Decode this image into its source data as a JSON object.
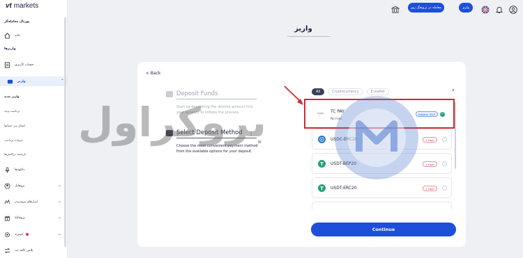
{
  "brand": {
    "logo_mark": "vt",
    "logo_text": "markets"
  },
  "sidebar": {
    "section_portal": "پورتال معامله‌گر",
    "home": "خانه",
    "section_transfers": "واریزها",
    "my_accounts": "حساب کاربری",
    "deposit": "واریز",
    "sub_new_deposit": "واریز جدید",
    "sub_withdraw": "برداشت وجه",
    "sub_internal_transfer": "انتقال بین حسابها",
    "sub_payment_history": "جزئیات پرداخت",
    "sub_transaction_history": "تاریخچه تراکنش‌ها",
    "downloads": "دانلودها",
    "profile": "پروفایل",
    "trading_tools": "ابزارهای پروتریدر",
    "promotions": "پروفایلهٔ",
    "settings": "کپیترید",
    "copy_trading": "پلاس کافه نت"
  },
  "topbar": {
    "demo_button": "معامله در ترویجگ روز",
    "deposit_button": "واریز",
    "icons": [
      "bank-icon",
      "uk-flag-icon",
      "bell-icon",
      "user-icon"
    ]
  },
  "page": {
    "title": "واریز"
  },
  "card": {
    "back_label": "< Back",
    "step1": {
      "title": "Deposit Funds",
      "desc": "Start by depositing the desired amount into your account to initiate the process."
    },
    "step2": {
      "title": "Select Deposit Method",
      "desc": "Choose the most convenient payment method from the available options for your deposit."
    },
    "tabs": [
      "All",
      "Cryptocurrency",
      "E-wallet"
    ],
    "selected_method": {
      "logo": "tcpay",
      "name": "TC PAY",
      "fees": "No Fees",
      "badge": "Instant, 24/7"
    },
    "methods": [
      {
        "name": "USDC-ERC20",
        "badge": "1 Hour",
        "icon": "usdc-icon",
        "color": "#2775ca"
      },
      {
        "name": "USDT-BEP20",
        "badge": "1 Hour",
        "icon": "tether-icon",
        "color": "#26a17b"
      },
      {
        "name": "USDT-ERC20",
        "badge": "1 Hour",
        "icon": "tether-icon",
        "color": "#26a17b"
      }
    ],
    "continue_label": "Continue"
  },
  "watermark": {
    "text": "بروکراول"
  },
  "colors": {
    "primary": "#1d4fd8",
    "highlight": "#d22a2a",
    "dark": "#1b1f3b"
  }
}
